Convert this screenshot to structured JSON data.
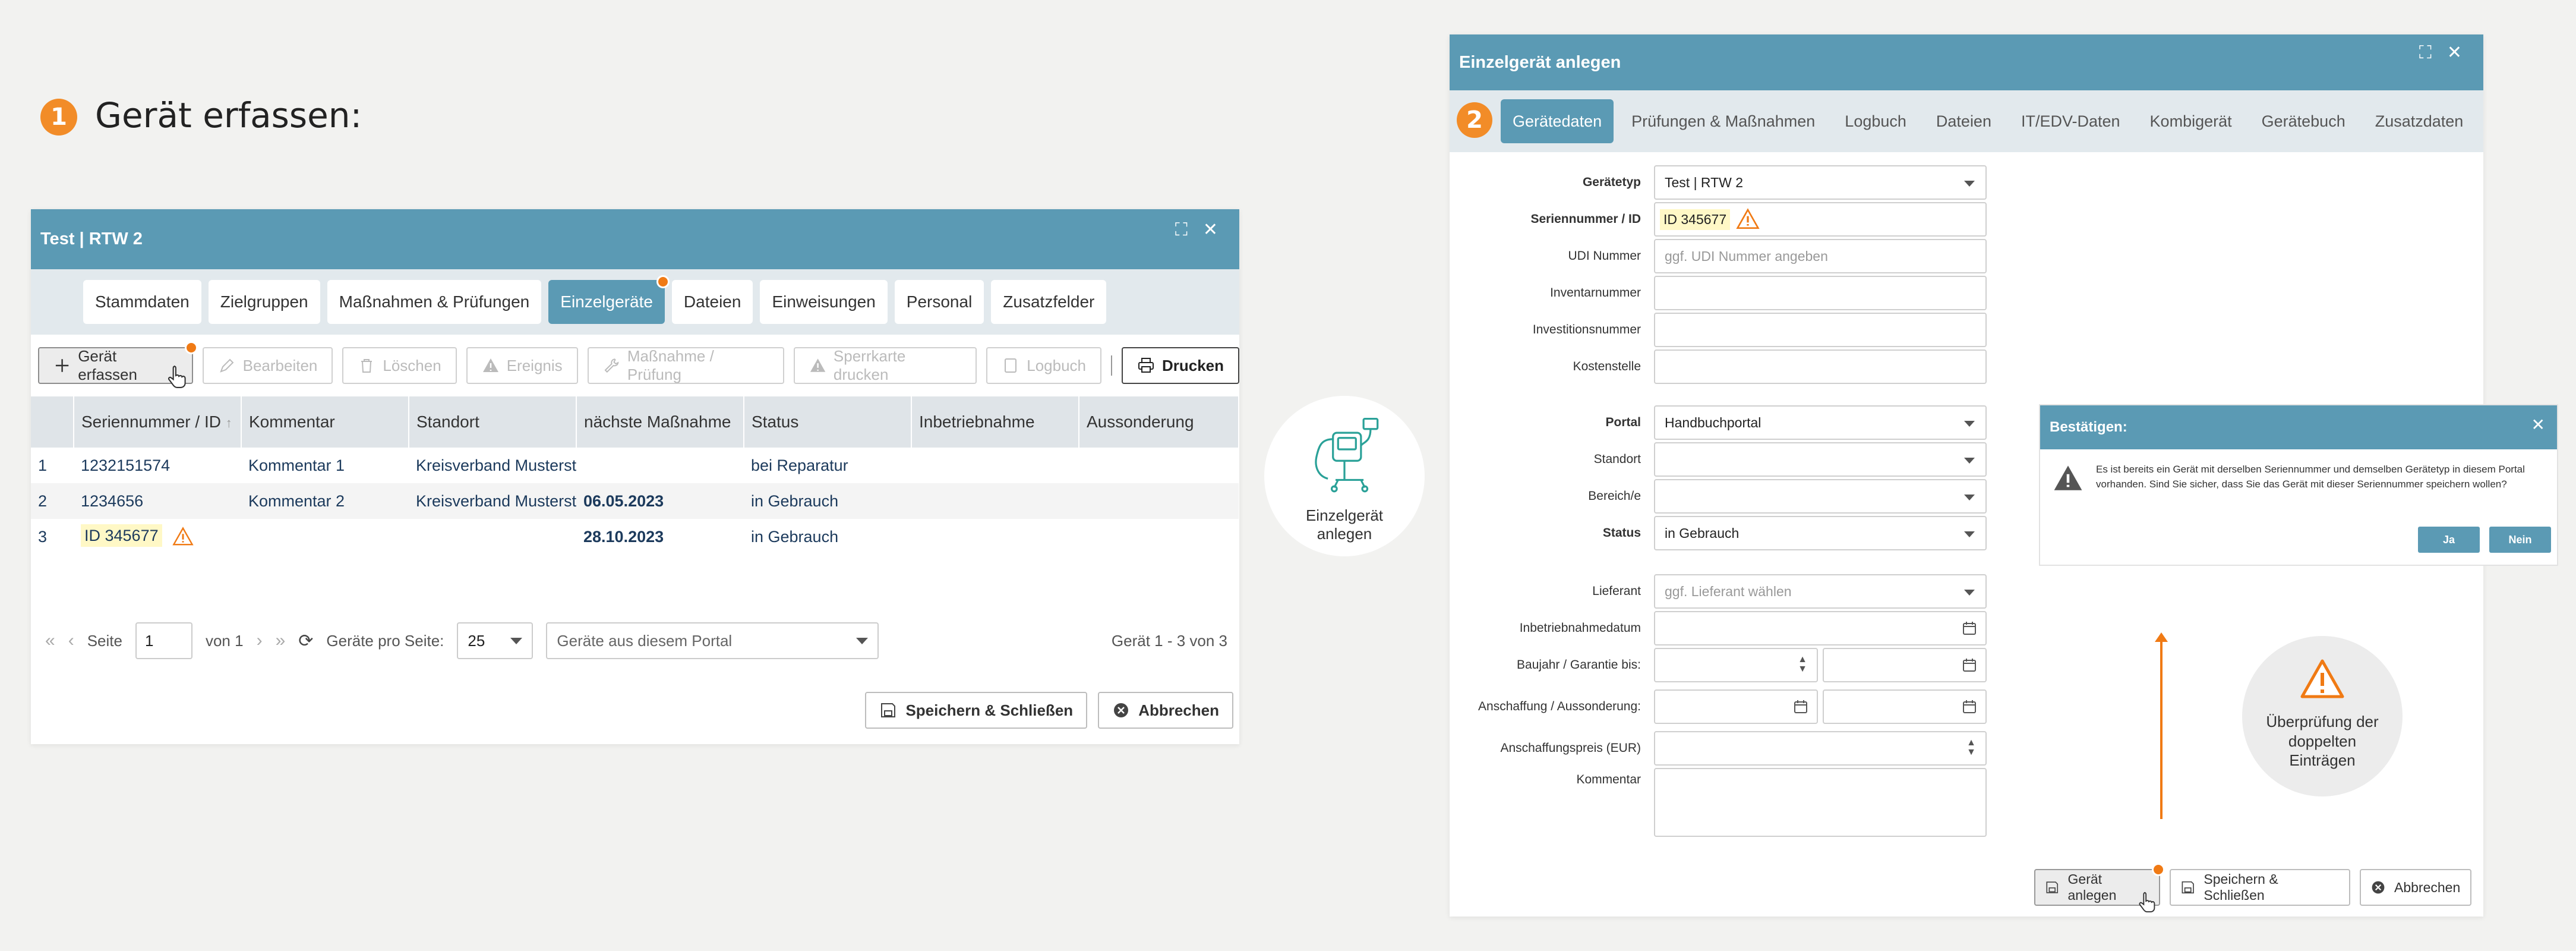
{
  "step1": {
    "number": "1",
    "title": "Gerät erfassen:"
  },
  "step2": {
    "number": "2"
  },
  "window1": {
    "title": "Test | RTW 2",
    "tabs": [
      "Stammdaten",
      "Zielgruppen",
      "Maßnahmen & Prüfungen",
      "Einzelgeräte",
      "Dateien",
      "Einweisungen",
      "Personal",
      "Zusatzfelder"
    ],
    "active_tab": "Einzelgeräte",
    "toolbar": {
      "add": "Gerät erfassen",
      "edit": "Bearbeiten",
      "delete": "Löschen",
      "event": "Ereignis",
      "measure": "Maßnahme / Prüfung",
      "lockcard": "Sperrkarte drucken",
      "logbook": "Logbuch",
      "print": "Drucken"
    },
    "table": {
      "headers": [
        "",
        "Seriennummer / ID",
        "Kommentar",
        "Standort",
        "nächste Maßnahme",
        "Status",
        "Inbetriebnahme",
        "Aussonderung"
      ],
      "sort_arrow": "↑",
      "rows": [
        {
          "n": "1",
          "serial": "1232151574",
          "comment": "Kommentar 1",
          "location": "Kreisverband Musterst",
          "next": "",
          "status": "bei Reparatur"
        },
        {
          "n": "2",
          "serial": "1234656",
          "comment": "Kommentar 2",
          "location": "Kreisverband Musterst",
          "next": "06.05.2023",
          "status": "in Gebrauch"
        },
        {
          "n": "3",
          "serial": "ID 345677",
          "comment": "",
          "location": "",
          "next": "28.10.2023",
          "status": "in Gebrauch"
        }
      ]
    },
    "pager": {
      "page_label": "Seite",
      "page": "1",
      "of_label": "von 1",
      "per_page_label": "Geräte pro Seite:",
      "per_page": "25",
      "filter": "Geräte aus diesem Portal",
      "count": "Gerät 1 - 3 von 3"
    },
    "footer": {
      "save_close": "Speichern & Schließen",
      "cancel": "Abbrechen"
    }
  },
  "middle_label": "Einzelgerät anlegen",
  "window2": {
    "title": "Einzelgerät anlegen",
    "tabs": [
      "Gerätedaten",
      "Prüfungen & Maßnahmen",
      "Logbuch",
      "Dateien",
      "IT/EDV-Daten",
      "Kombigerät",
      "Gerätebuch",
      "Zusatzdaten"
    ],
    "active_tab": "Gerätedaten",
    "fields": {
      "type_label": "Gerätetyp",
      "type_value": "Test | RTW 2",
      "serial_label": "Seriennummer / ID",
      "serial_value": "ID 345677",
      "udi_label": "UDI Nummer",
      "udi_placeholder": "ggf. UDI Nummer angeben",
      "inventory_label": "Inventarnummer",
      "investment_label": "Investitionsnummer",
      "costcenter_label": "Kostenstelle",
      "portal_label": "Portal",
      "portal_value": "Handbuchportal",
      "location_label": "Standort",
      "area_label": "Bereich/e",
      "status_label": "Status",
      "status_value": "in Gebrauch",
      "supplier_label": "Lieferant",
      "supplier_placeholder": "ggf. Lieferant wählen",
      "commission_label": "Inbetriebnahmedatum",
      "year_label": "Baujahr / Garantie bis:",
      "acquisition_label": "Anschaffung / Aussonderung:",
      "price_label": "Anschaffungspreis (EUR)",
      "comment_label": "Kommentar"
    },
    "footer": {
      "create": "Gerät anlegen",
      "save_close": "Speichern & Schließen",
      "cancel": "Abbrechen"
    }
  },
  "confirm": {
    "title": "Bestätigen:",
    "message": "Es ist bereits ein Gerät mit derselben Seriennummer und demselben Gerätetyp in diesem Portal vorhanden. Sind Sie sicher, dass Sie das Gerät mit dieser Seriennummer speichern wollen?",
    "yes": "Ja",
    "no": "Nein"
  },
  "check_label": "Überprüfung der doppelten Einträgen",
  "colors": {
    "accent": "#5b9ab4",
    "orange": "#f28c28",
    "warning": "#f07a14",
    "date_red": "#8b1a1a"
  },
  "icons": [
    "plus-icon",
    "pencil-icon",
    "trash-icon",
    "warning-icon",
    "wrench-icon",
    "book-icon",
    "printer-icon",
    "save-icon",
    "cancel-icon",
    "expand-icon",
    "close-icon",
    "calendar-icon",
    "refresh-icon",
    "cursor-hand-icon",
    "ventilator-icon"
  ]
}
